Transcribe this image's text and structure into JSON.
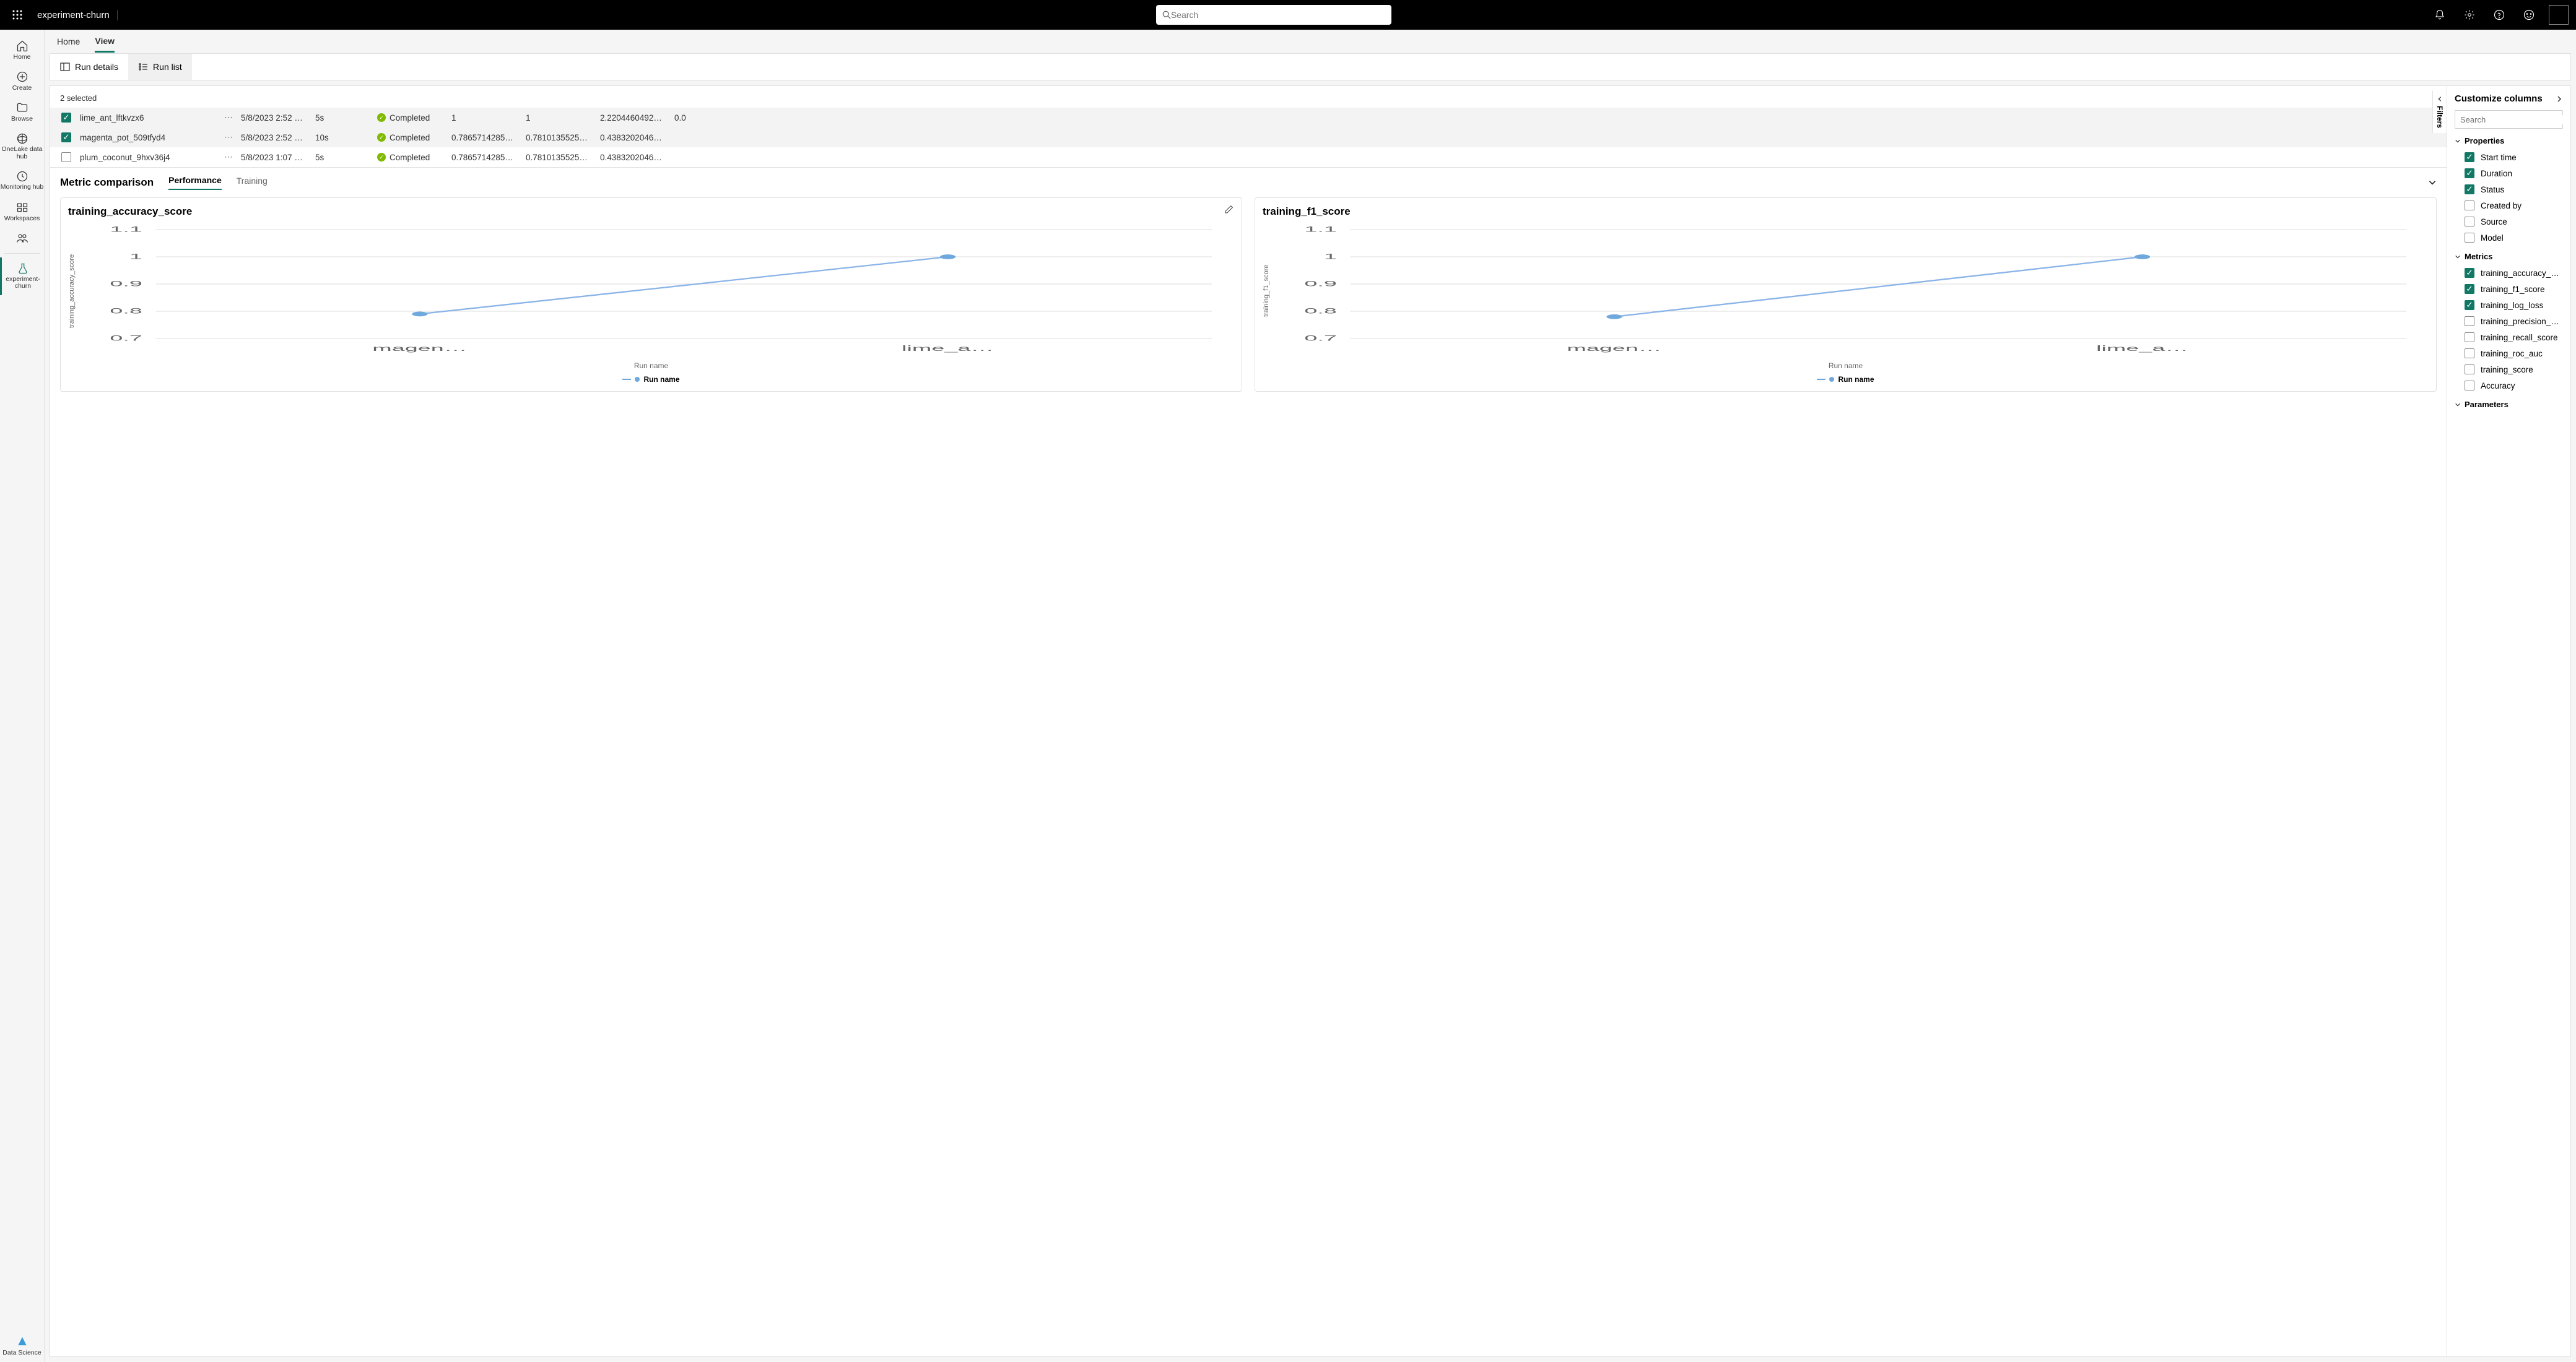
{
  "topbar": {
    "title": "experiment-churn",
    "search_placeholder": "Search"
  },
  "leftrail": [
    {
      "label": "Home",
      "icon": "home"
    },
    {
      "label": "Create",
      "icon": "plus-circle"
    },
    {
      "label": "Browse",
      "icon": "folder"
    },
    {
      "label": "OneLake data hub",
      "icon": "globe"
    },
    {
      "label": "Monitoring hub",
      "icon": "monitor"
    },
    {
      "label": "Workspaces",
      "icon": "workspaces"
    },
    {
      "label": "",
      "icon": "people"
    }
  ],
  "leftrail_active": {
    "label": "experiment-churn",
    "icon": "flask"
  },
  "leftrail_bottom": {
    "label": "Data Science",
    "icon": "ds"
  },
  "pagetabs": [
    "Home",
    "View"
  ],
  "pagetabs_active": "View",
  "toolbar": {
    "run_details": "Run details",
    "run_list": "Run list"
  },
  "selected_text": "2 selected",
  "runs": [
    {
      "checked": true,
      "name": "lime_ant_lftkvzx6",
      "time": "5/8/2023 2:52 …",
      "duration": "5s",
      "status": "Completed",
      "c1": "1",
      "c2": "1",
      "c3": "2.2204460492…",
      "c4": "0.0"
    },
    {
      "checked": true,
      "name": "magenta_pot_509tfyd4",
      "time": "5/8/2023 2:52 …",
      "duration": "10s",
      "status": "Completed",
      "c1": "0.7865714285…",
      "c2": "0.7810135525…",
      "c3": "0.4383202046…",
      "c4": ""
    },
    {
      "checked": false,
      "name": "plum_coconut_9hxv36j4",
      "time": "5/8/2023 1:07 …",
      "duration": "5s",
      "status": "Completed",
      "c1": "0.7865714285…",
      "c2": "0.7810135525…",
      "c3": "0.4383202046…",
      "c4": ""
    }
  ],
  "filters_label": "Filters",
  "metric_section": {
    "title": "Metric comparison",
    "subtabs": [
      "Performance",
      "Training"
    ],
    "active_subtab": "Performance"
  },
  "chart_data": [
    {
      "type": "line",
      "title": "training_accuracy_score",
      "ylabel": "training_accuracy_score",
      "xlabel": "Run name",
      "legend": "Run name",
      "categories": [
        "magen…",
        "lime_a…"
      ],
      "values": [
        0.79,
        1.0
      ],
      "ylim": [
        0.7,
        1.1
      ],
      "yticks": [
        0.7,
        0.8,
        0.9,
        1,
        1.1
      ]
    },
    {
      "type": "line",
      "title": "training_f1_score",
      "ylabel": "training_f1_score",
      "xlabel": "Run name",
      "legend": "Run name",
      "categories": [
        "magen…",
        "lime_a…"
      ],
      "values": [
        0.78,
        1.0
      ],
      "ylim": [
        0.7,
        1.1
      ],
      "yticks": [
        0.7,
        0.8,
        0.9,
        1,
        1.1
      ]
    }
  ],
  "customize": {
    "title": "Customize columns",
    "search_placeholder": "Search",
    "groups": [
      {
        "name": "Properties",
        "options": [
          {
            "label": "Start time",
            "checked": true
          },
          {
            "label": "Duration",
            "checked": true
          },
          {
            "label": "Status",
            "checked": true
          },
          {
            "label": "Created by",
            "checked": false
          },
          {
            "label": "Source",
            "checked": false
          },
          {
            "label": "Model",
            "checked": false
          }
        ]
      },
      {
        "name": "Metrics",
        "options": [
          {
            "label": "training_accuracy_score",
            "checked": true
          },
          {
            "label": "training_f1_score",
            "checked": true
          },
          {
            "label": "training_log_loss",
            "checked": true
          },
          {
            "label": "training_precision_score",
            "checked": false
          },
          {
            "label": "training_recall_score",
            "checked": false
          },
          {
            "label": "training_roc_auc",
            "checked": false
          },
          {
            "label": "training_score",
            "checked": false
          },
          {
            "label": "Accuracy",
            "checked": false
          }
        ]
      },
      {
        "name": "Parameters",
        "options": []
      }
    ]
  }
}
